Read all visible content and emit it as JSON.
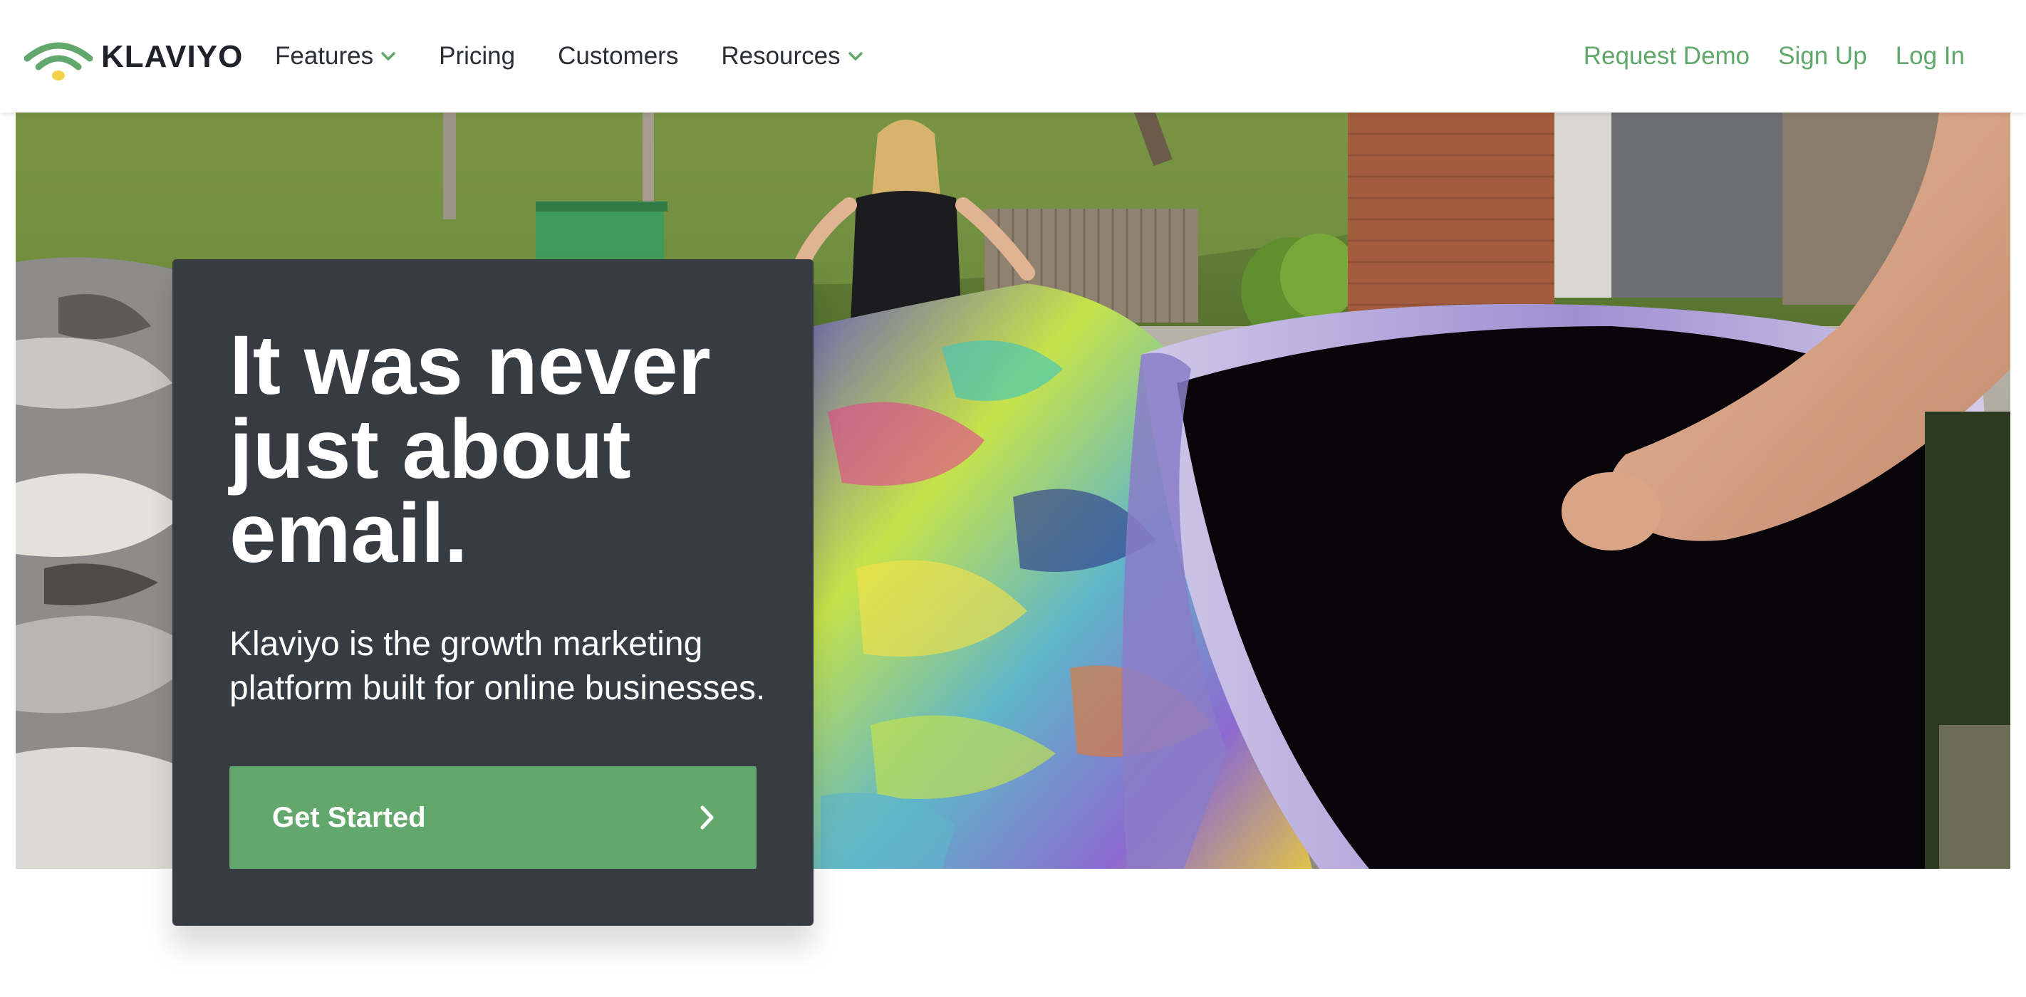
{
  "brand": {
    "name": "KLAVIYO",
    "logo_icon": "wifi-arc-logo",
    "accent_color": "#62a86c",
    "logo_yellow": "#f2d24b"
  },
  "nav": {
    "items": [
      {
        "label": "Features",
        "has_dropdown": true
      },
      {
        "label": "Pricing",
        "has_dropdown": false
      },
      {
        "label": "Customers",
        "has_dropdown": false
      },
      {
        "label": "Resources",
        "has_dropdown": true
      }
    ],
    "right_links": [
      {
        "label": "Request Demo"
      },
      {
        "label": "Sign Up"
      },
      {
        "label": "Log In"
      }
    ]
  },
  "hero": {
    "background": "photo-people-folding-colorful-fabric",
    "card_color": "#373b42",
    "title_lines": [
      "It was never",
      "just about",
      "email."
    ],
    "subtitle_lines": [
      "Klaviyo is the growth marketing",
      "platform built for online businesses."
    ],
    "cta_label": "Get Started",
    "cta_icon": "chevron-right-icon"
  }
}
